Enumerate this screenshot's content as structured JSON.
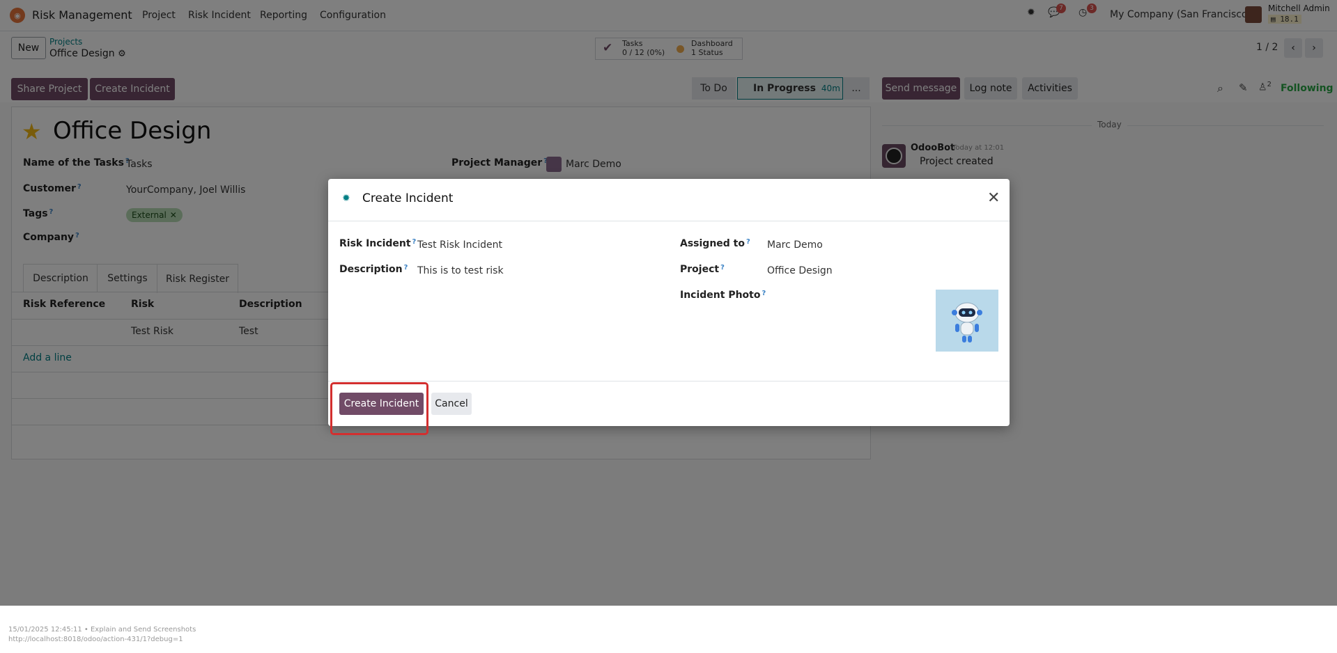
{
  "navbar": {
    "app_name": "Risk Management",
    "menu": [
      "Project",
      "Risk Incident",
      "Reporting",
      "Configuration"
    ],
    "messages_count": "7",
    "activities_count": "3",
    "company": "My Company (San Francisco)",
    "user_name": "Mitchell Admin",
    "version": "18.1"
  },
  "control_panel": {
    "new_label": "New",
    "breadcrumb_parent": "Projects",
    "breadcrumb_current": "Office Design",
    "tasks_title": "Tasks",
    "tasks_value": "0 / 12 (0%)",
    "dashboard_title": "Dashboard",
    "dashboard_value": "1 Status",
    "pager": "1 / 2"
  },
  "actions": {
    "share_project": "Share Project",
    "create_incident": "Create Incident"
  },
  "pipeline": {
    "stages": [
      "To Do",
      "In Progress",
      "..."
    ],
    "active_time": "40m"
  },
  "form": {
    "title": "Office Design",
    "fields": {
      "tasks_label": "Name of the Tasks",
      "tasks_value": "Tasks",
      "customer_label": "Customer",
      "customer_value": "YourCompany, Joel Willis",
      "tags_label": "Tags",
      "tag": "External",
      "company_label": "Company",
      "manager_label": "Project Manager",
      "manager_value": "Marc Demo"
    },
    "tabs": [
      "Description",
      "Settings",
      "Risk Register"
    ],
    "table": {
      "headers": [
        "Risk Reference",
        "Risk",
        "Description"
      ],
      "rows": [
        [
          "",
          "Test Risk",
          "Test"
        ]
      ],
      "add_line": "Add a line"
    }
  },
  "chatter": {
    "send_message": "Send message",
    "log_note": "Log note",
    "activities": "Activities",
    "followers_count": "2",
    "following": "Following",
    "date_separator": "Today",
    "message": {
      "author": "OdooBot",
      "time": "Today at 12:01",
      "body": "Project created"
    }
  },
  "modal": {
    "title": "Create Incident",
    "risk_incident_label": "Risk Incident",
    "risk_incident_value": "Test Risk Incident",
    "description_label": "Description",
    "description_value": "This is to test risk",
    "assigned_label": "Assigned to",
    "assigned_value": "Marc Demo",
    "project_label": "Project",
    "project_value": "Office Design",
    "photo_label": "Incident Photo",
    "create_button": "Create Incident",
    "cancel_button": "Cancel"
  },
  "footer": {
    "line1": "15/01/2025 12:45:11 • Explain and Send Screenshots",
    "line2": "http://localhost:8018/odoo/action-431/1?debug=1"
  },
  "colors": {
    "primary": "#714b67",
    "teal": "#017e84",
    "highlight": "#d32f2f",
    "following": "#28a745"
  }
}
